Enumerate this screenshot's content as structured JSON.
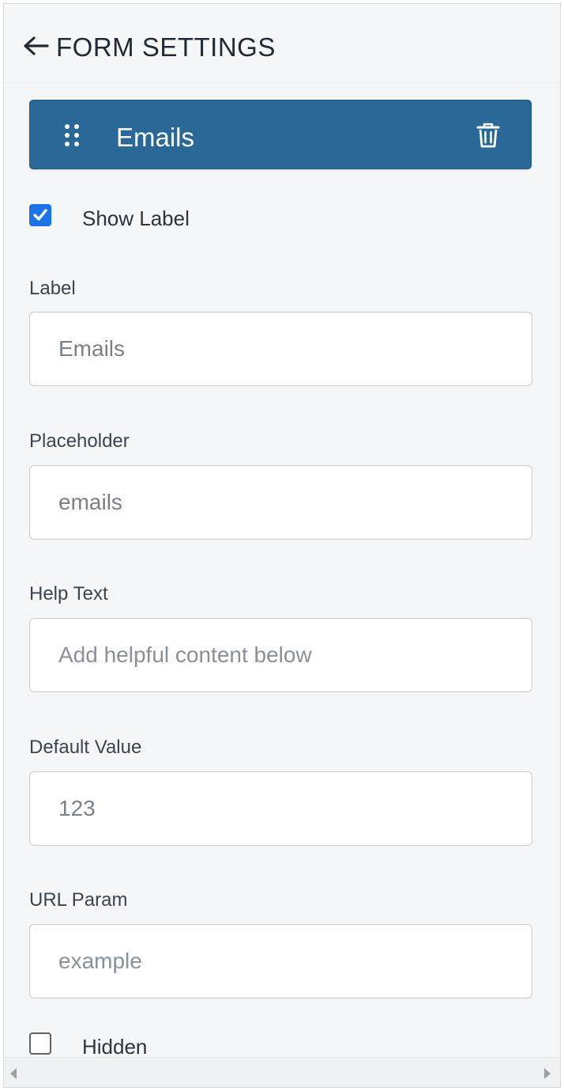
{
  "header": {
    "back_icon": "arrow-left-icon",
    "title": "FORM SETTINGS"
  },
  "field": {
    "name": "Emails",
    "drag_icon": "drag-handle-icon",
    "delete_icon": "trash-icon",
    "color": "#296897"
  },
  "show_label": {
    "label": "Show Label",
    "checked": true
  },
  "label_field": {
    "label": "Label",
    "value": "Emails"
  },
  "placeholder_field": {
    "label": "Placeholder",
    "value": "emails"
  },
  "help_text_field": {
    "label": "Help Text",
    "placeholder": "Add helpful content below"
  },
  "default_value_field": {
    "label": "Default Value",
    "value": "123"
  },
  "url_param_field": {
    "label": "URL Param",
    "placeholder": "example"
  },
  "hidden": {
    "label": "Hidden",
    "checked": false
  },
  "scrollbar": {
    "left_icon": "scroll-left-arrow-icon",
    "right_icon": "scroll-right-arrow-icon"
  },
  "colors": {
    "accent": "#1a73e8",
    "banner": "#296897",
    "panel_bg": "#f4f6f8"
  }
}
